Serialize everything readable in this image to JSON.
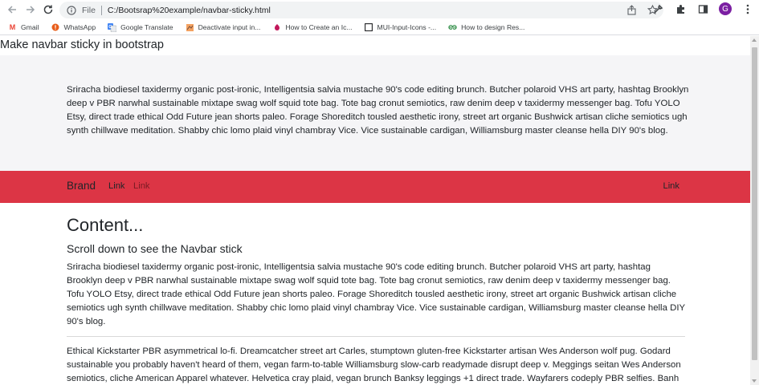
{
  "browser": {
    "url_scheme": "File",
    "url": "C:/Bootsrap%20example/navbar-sticky.html",
    "avatar_letter": "G"
  },
  "bookmarks": [
    {
      "label": "Gmail",
      "icon": "gmail-icon"
    },
    {
      "label": "WhatsApp",
      "icon": "whatsapp-icon"
    },
    {
      "label": "Google Translate",
      "icon": "google-translate-icon"
    },
    {
      "label": "Deactivate input in...",
      "icon": "deactivate-icon"
    },
    {
      "label": "How to Create an Ic...",
      "icon": "how-to-create-icon"
    },
    {
      "label": "MUI-Input-Icons -...",
      "icon": "mui-icon"
    },
    {
      "label": "How to design Res...",
      "icon": "gfg-icon"
    }
  ],
  "page": {
    "title": "Make navbar sticky in bootstrap",
    "jumbotron_text": "Sriracha biodiesel taxidermy organic post-ironic, Intelligentsia salvia mustache 90's code editing brunch. Butcher polaroid VHS art party, hashtag Brooklyn deep v PBR narwhal sustainable mixtape swag wolf squid tote bag. Tote bag cronut semiotics, raw denim deep v taxidermy messenger bag. Tofu YOLO Etsy, direct trade ethical Odd Future jean shorts paleo. Forage Shoreditch tousled aesthetic irony, street art organic Bushwick artisan cliche semiotics ugh synth chillwave meditation. Shabby chic lomo plaid vinyl chambray Vice. Vice sustainable cardigan, Williamsburg master cleanse hella DIY 90's blog.",
    "navbar": {
      "brand": "Brand",
      "link_1": "Link",
      "link_2": "Link",
      "link_right": "Link",
      "background": "#dc3545"
    },
    "content": {
      "heading": "Content...",
      "subheading": "Scroll down to see the Navbar stick",
      "paragraph_1": "Sriracha biodiesel taxidermy organic post-ironic, Intelligentsia salvia mustache 90's code editing brunch. Butcher polaroid VHS art party, hashtag Brooklyn deep v PBR narwhal sustainable mixtape swag wolf squid tote bag. Tote bag cronut semiotics, raw denim deep v taxidermy messenger bag. Tofu YOLO Etsy, direct trade ethical Odd Future jean shorts paleo. Forage Shoreditch tousled aesthetic irony, street art organic Bushwick artisan cliche semiotics ugh synth chillwave meditation. Shabby chic lomo plaid vinyl chambray Vice. Vice sustainable cardigan, Williamsburg master cleanse hella DIY 90's blog.",
      "paragraph_2": "Ethical Kickstarter PBR asymmetrical lo-fi. Dreamcatcher street art Carles, stumptown gluten-free Kickstarter artisan Wes Anderson wolf pug. Godard sustainable you probably haven't heard of them, vegan farm-to-table Williamsburg slow-carb readymade disrupt deep v. Meggings seitan Wes Anderson semiotics, cliche American Apparel whatever. Helvetica cray plaid, vegan brunch Banksy leggings +1 direct trade. Wayfarers codeply PBR selfies. Banh mi McSweeney's Shoreditch selfies, forage fingerstache food truck occupy YOLO Pitchfork fixie iPhone fanny pack art party Portland."
    }
  }
}
